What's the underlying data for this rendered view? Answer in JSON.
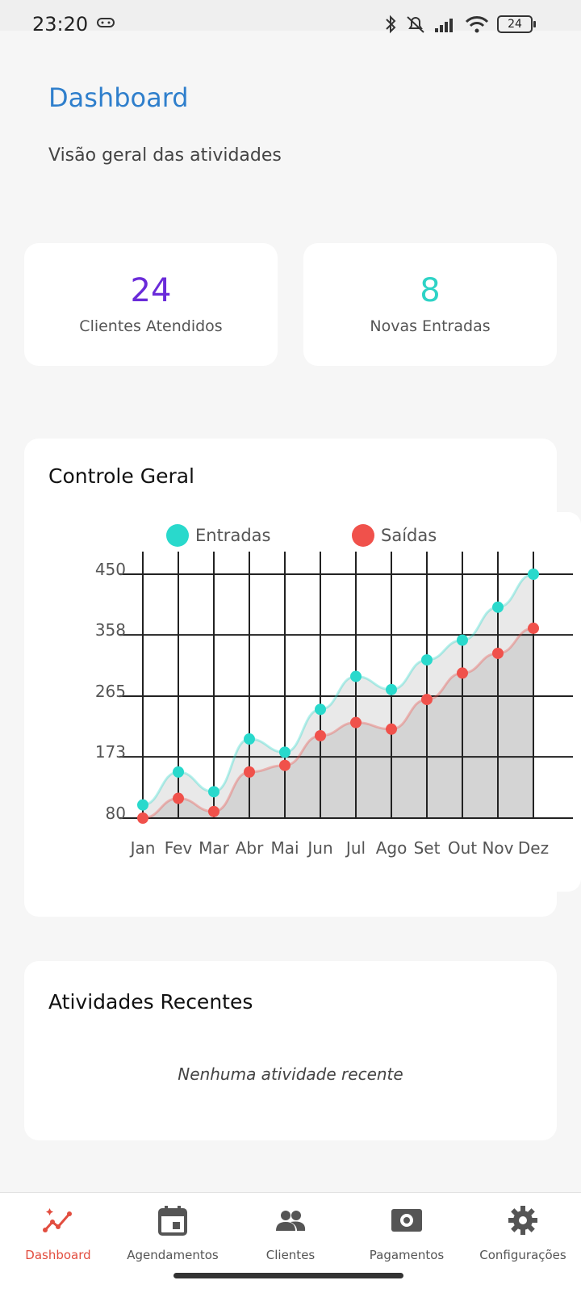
{
  "status_bar": {
    "time": "23:20",
    "battery": "24",
    "icons": [
      "gamepad-icon",
      "bluetooth-icon",
      "muted-bell-icon",
      "signal-icon",
      "wifi-icon",
      "battery-icon"
    ]
  },
  "header": {
    "title": "Dashboard",
    "subtitle": "Visão geral das atividades"
  },
  "stats": [
    {
      "value": "24",
      "label": "Clientes Atendidos",
      "color": "#6a2bd9"
    },
    {
      "value": "8",
      "label": "Novas Entradas",
      "color": "#2ed3c6"
    }
  ],
  "chart_card": {
    "title": "Controle Geral"
  },
  "chart_data": {
    "type": "area",
    "categories": [
      "Jan",
      "Fev",
      "Mar",
      "Abr",
      "Mai",
      "Jun",
      "Jul",
      "Ago",
      "Set",
      "Out",
      "Nov",
      "Dez"
    ],
    "series": [
      {
        "name": "Entradas",
        "color": "#29d9cc",
        "values": [
          100,
          150,
          120,
          200,
          180,
          245,
          295,
          275,
          320,
          350,
          400,
          450
        ]
      },
      {
        "name": "Saídas",
        "color": "#f0514b",
        "values": [
          80,
          110,
          90,
          150,
          160,
          205,
          225,
          215,
          260,
          300,
          330,
          368
        ]
      }
    ],
    "y_ticks": [
      "80",
      "173",
      "265",
      "358",
      "450"
    ],
    "ylim": [
      80,
      450
    ],
    "grid": true,
    "legend": "top"
  },
  "activity": {
    "title": "Atividades Recentes",
    "empty_text": "Nenhuma atividade recente"
  },
  "nav": {
    "items": [
      {
        "label": "Dashboard",
        "icon": "chart-line-icon",
        "active": true
      },
      {
        "label": "Agendamentos",
        "icon": "calendar-icon",
        "active": false
      },
      {
        "label": "Clientes",
        "icon": "people-icon",
        "active": false
      },
      {
        "label": "Pagamentos",
        "icon": "money-icon",
        "active": false
      },
      {
        "label": "Configurações",
        "icon": "gear-icon",
        "active": false
      }
    ],
    "active_color": "#e24d3f",
    "inactive_color": "#555555"
  }
}
